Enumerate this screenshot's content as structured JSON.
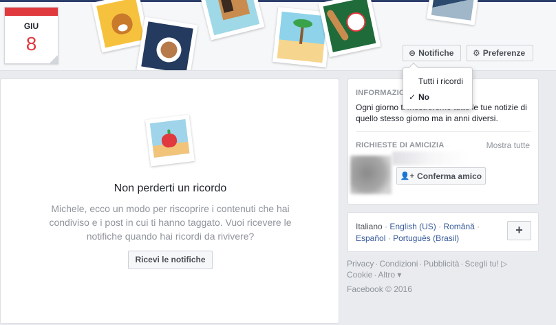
{
  "calendar": {
    "month": "GIU",
    "day": "8"
  },
  "header": {
    "notifications_label": "Notifiche",
    "preferences_label": "Preferenze"
  },
  "dropdown": {
    "items": [
      {
        "label": "Tutti i ricordi",
        "selected": false
      },
      {
        "label": "No",
        "selected": true
      }
    ],
    "check_glyph": "✓"
  },
  "main": {
    "title": "Non perderti un ricordo",
    "description": "Michele, ecco un modo per riscoprire i contenuti che hai condiviso e i post in cui ti hanno taggato. Vuoi ricevere le notifiche quando hai ricordi da rivivere?",
    "cta_label": "Ricevi le notifiche"
  },
  "sidebar": {
    "info_title": "INFORMAZIO",
    "info_text": "Ogni giorno ti mostreremo tutte le tue notizie di quello stesso giorno ma in anni diversi.",
    "requests_title": "RICHIESTE DI AMICIZIA",
    "see_all": "Mostra tutte",
    "confirm_label": "Conferma amico"
  },
  "languages": {
    "current": "Italiano",
    "links": [
      "English (US)",
      "Română",
      "Español",
      "Português (Brasil)"
    ],
    "separator": "·",
    "add_label": "+"
  },
  "footer": {
    "links": [
      "Privacy",
      "Condizioni",
      "Pubblicità",
      "Scegli tu!",
      "Cookie",
      "Altro"
    ],
    "copyright": "Facebook © 2016"
  },
  "colors": {
    "accent_red": "#e0393e",
    "link_blue": "#365899",
    "muted_text": "#90949c"
  }
}
